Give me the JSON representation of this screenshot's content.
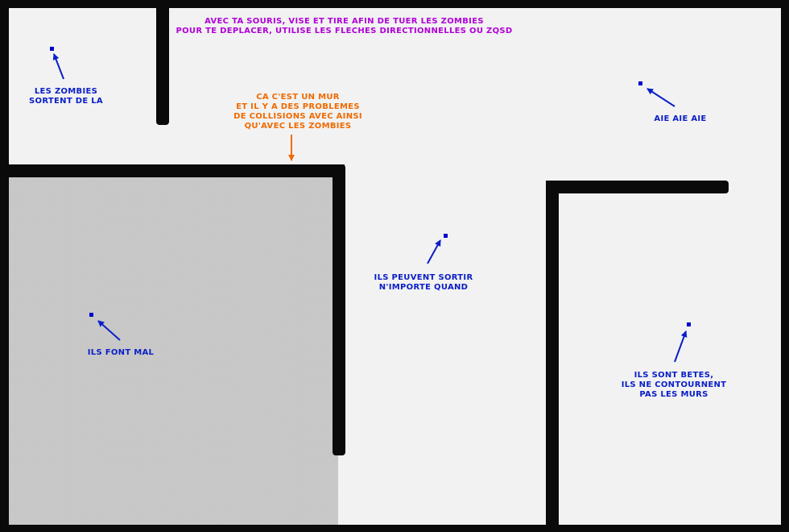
{
  "colors": {
    "wall": "#0a0a0a",
    "floor": "#f2f2f2",
    "hatched_floor": "#d2d2d2",
    "zombie": "#0000cc",
    "annotation_blue": "#0a1ec8",
    "annotation_purple": "#b000d8",
    "annotation_orange": "#f06a00"
  },
  "instructions": {
    "line1": "AVEC TA SOURIS, VISE ET TIRE AFIN DE TUER LES ZOMBIES",
    "line2": "POUR TE DEPLACER, UTILISE LES FLECHES DIRECTIONNELLES OU ZQSD"
  },
  "wall_note": {
    "line1": "CA C'EST UN MUR",
    "line2": "ET IL Y A DES PROBLEMES",
    "line3": "DE COLLISIONS AVEC AINSI",
    "line4": "QU'AVEC LES ZOMBIES"
  },
  "annotations": {
    "spawn": {
      "line1": "LES ZOMBIES",
      "line2": "SORTENT DE LA"
    },
    "ouch": {
      "line1": "AIE AIE AIE"
    },
    "hurt": {
      "line1": "ILS FONT MAL"
    },
    "anytime": {
      "line1": "ILS PEUVENT SORTIR",
      "line2": "N'IMPORTE QUAND"
    },
    "dumb": {
      "line1": "ILS SONT BETES,",
      "line2": "ILS NE CONTOURNENT",
      "line3": "PAS LES MURS"
    }
  },
  "arrow_icons": [
    "arrow-up-right-icon",
    "arrow-down-icon"
  ]
}
